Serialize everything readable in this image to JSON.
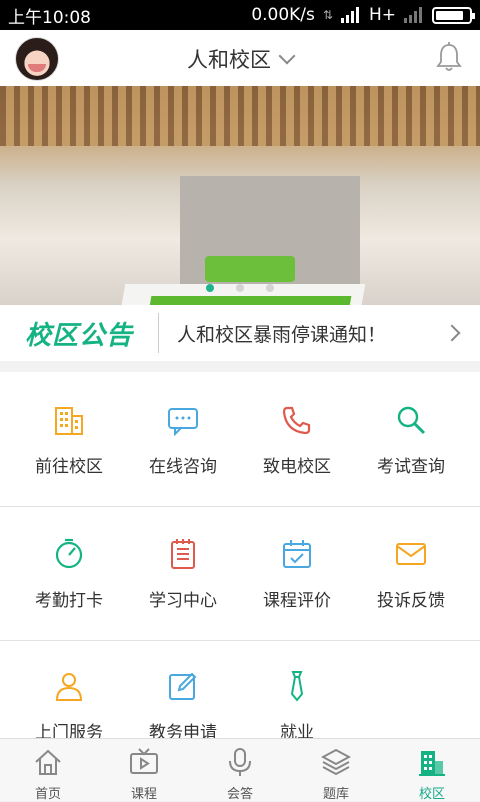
{
  "status_bar": {
    "time": "上午10:08",
    "speed": "0.00K/s",
    "network": "H+",
    "battery_level": 0.85
  },
  "header": {
    "title": "人和校区"
  },
  "banner": {
    "slide_count": 3,
    "active_slide": 1
  },
  "notice": {
    "label": "校区公告",
    "text": "人和校区暴雨停课通知！"
  },
  "grid": {
    "rows": [
      [
        {
          "label": "前往校区",
          "icon": "building-icon"
        },
        {
          "label": "在线咨询",
          "icon": "chat-icon"
        },
        {
          "label": "致电校区",
          "icon": "phone-icon"
        },
        {
          "label": "考试查询",
          "icon": "search-icon"
        }
      ],
      [
        {
          "label": "考勤打卡",
          "icon": "gauge-icon"
        },
        {
          "label": "学习中心",
          "icon": "notebook-icon"
        },
        {
          "label": "课程评价",
          "icon": "calendar-check-icon"
        },
        {
          "label": "投诉反馈",
          "icon": "mail-icon"
        }
      ],
      [
        {
          "label": "上门服务",
          "icon": "person-icon"
        },
        {
          "label": "教务申请",
          "icon": "edit-icon"
        },
        {
          "label": "就业",
          "icon": "tie-icon"
        }
      ]
    ]
  },
  "tabbar": {
    "tabs": [
      {
        "label": "首页",
        "icon": "home-icon"
      },
      {
        "label": "课程",
        "icon": "tv-icon"
      },
      {
        "label": "会答",
        "icon": "mic-icon"
      },
      {
        "label": "题库",
        "icon": "layers-icon"
      },
      {
        "label": "校区",
        "icon": "campus-icon",
        "active": true
      }
    ]
  },
  "colors": {
    "accent": "#15b383",
    "orange": "#f5a623",
    "red": "#e0594f",
    "blue": "#4aa8e0"
  }
}
